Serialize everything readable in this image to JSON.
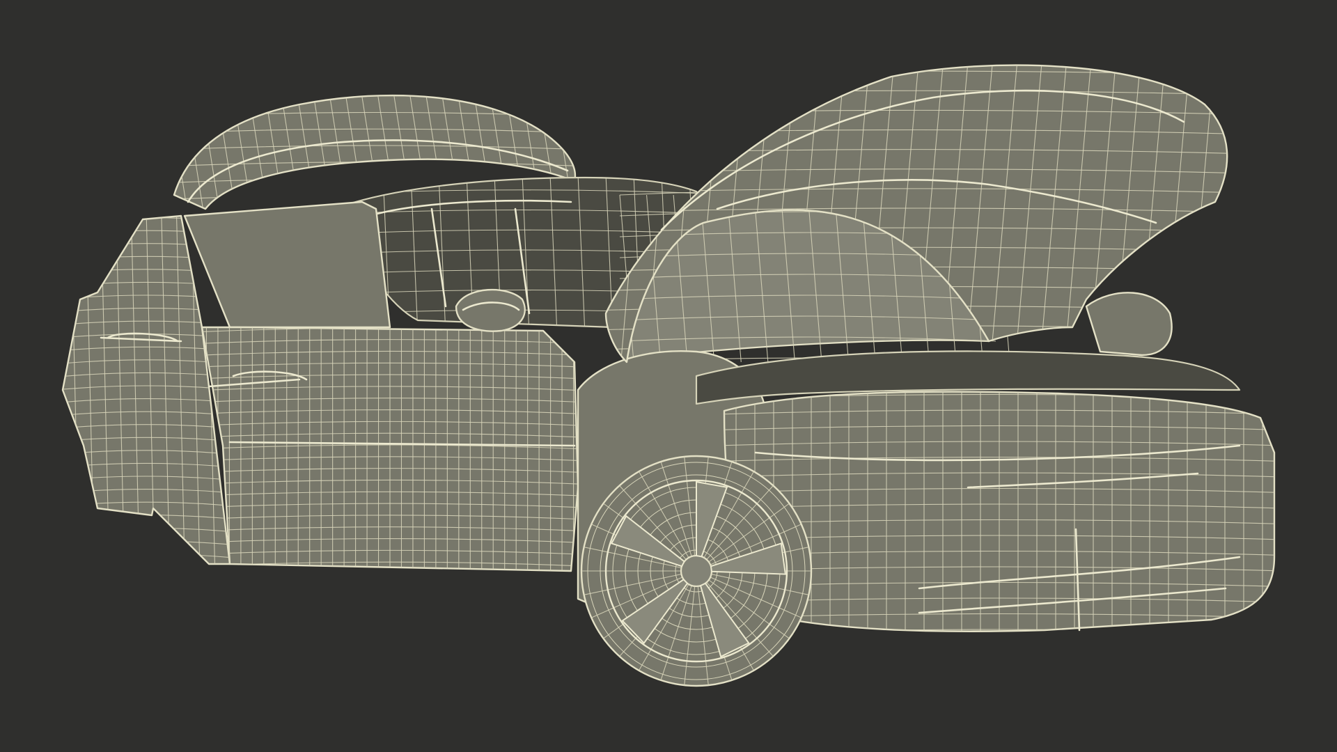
{
  "scene": {
    "background_color": "#2f2f2d",
    "body_fill_color": "#77776a",
    "wire_color": "#e4e1c6",
    "subject": "wireframe-car-3d-render",
    "doors": "open",
    "hood": "open"
  }
}
